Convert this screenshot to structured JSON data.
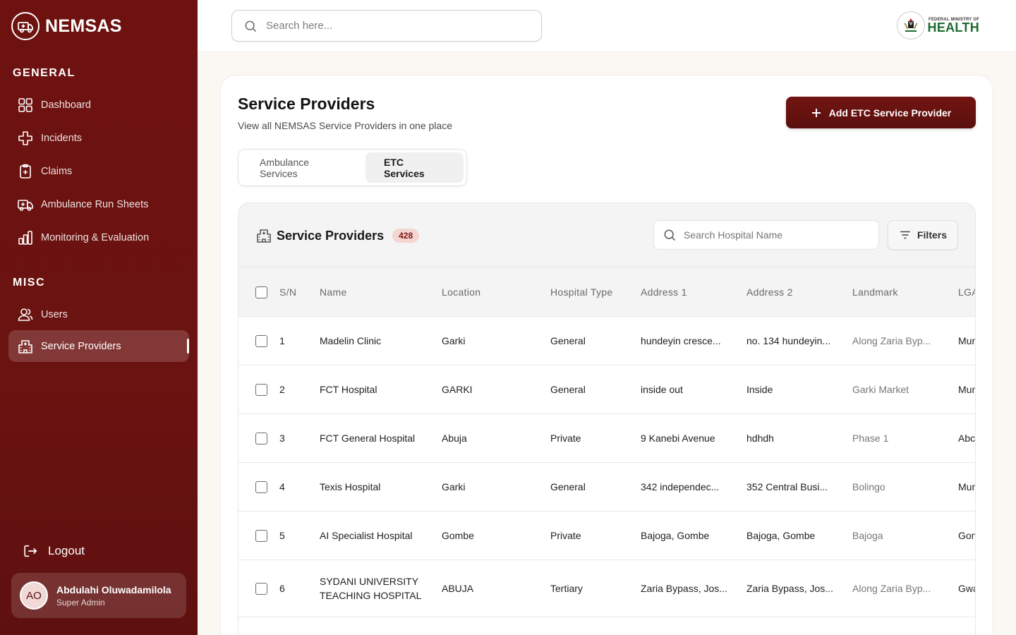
{
  "brand": {
    "name": "NEMSAS"
  },
  "sidebar": {
    "general_title": "GENERAL",
    "misc_title": "MISC",
    "items": [
      {
        "label": "Dashboard"
      },
      {
        "label": "Incidents"
      },
      {
        "label": "Claims"
      },
      {
        "label": "Ambulance Run Sheets"
      },
      {
        "label": "Monitoring & Evaluation"
      },
      {
        "label": "Users"
      },
      {
        "label": "Service Providers"
      }
    ],
    "logout_label": "Logout",
    "user": {
      "initials": "AO",
      "name": "Abdulahi Oluwadamilola",
      "role": "Super Admin"
    }
  },
  "header": {
    "search_placeholder": "Search here...",
    "ministry_small": "FEDERAL MINISTRY OF",
    "ministry_big": "HEALTH"
  },
  "page": {
    "title": "Service Providers",
    "subtitle": "View all NEMSAS Service Providers in one place",
    "add_button": "Add ETC Service Provider",
    "tabs": [
      {
        "label": "Ambulance Services",
        "active": false
      },
      {
        "label": "ETC Services",
        "active": true
      }
    ]
  },
  "panel": {
    "title": "Service Providers",
    "count": "428",
    "search_placeholder": "Search Hospital Name",
    "filters_label": "Filters"
  },
  "table": {
    "columns": [
      "S/N",
      "Name",
      "Location",
      "Hospital Type",
      "Address 1",
      "Address 2",
      "Landmark",
      "LGA"
    ],
    "rows": [
      {
        "sn": "1",
        "name": "Madelin Clinic",
        "location": "Garki",
        "type": "General",
        "address1": "hundeyin cresce...",
        "address2": "no. 134 hundeyin...",
        "landmark": "Along Zaria Byp...",
        "lga": "Mun"
      },
      {
        "sn": "2",
        "name": "FCT Hospital",
        "location": "GARKI",
        "type": "General",
        "address1": "inside out",
        "address2": "Inside",
        "landmark": "Garki Market",
        "lga": "Mun"
      },
      {
        "sn": "3",
        "name": "FCT General Hospital",
        "location": "Abuja",
        "type": "Private",
        "address1": "9 Kanebi Avenue",
        "address2": "hdhdh",
        "landmark": "Phase 1",
        "lga": "Abc"
      },
      {
        "sn": "4",
        "name": "Texis Hospital",
        "location": "Garki",
        "type": "General",
        "address1": "342 independec...",
        "address2": "352 Central Busi...",
        "landmark": "Bolingo",
        "lga": "Mun"
      },
      {
        "sn": "5",
        "name": "AI Specialist Hospital",
        "location": "Gombe",
        "type": "Private",
        "address1": "Bajoga, Gombe",
        "address2": "Bajoga, Gombe",
        "landmark": "Bajoga",
        "lga": "Gon"
      },
      {
        "sn": "6",
        "name": "SYDANI UNIVERSITY TEACHING HOSPITAL",
        "location": "ABUJA",
        "type": "Tertiary",
        "address1": "Zaria Bypass, Jos...",
        "address2": "Zaria Bypass, Jos...",
        "landmark": "Along Zaria Byp...",
        "lga": "Gwa"
      }
    ]
  },
  "colors": {
    "brand": "#6e1210",
    "badge_bg": "#f4d5d2",
    "health_green": "#1d6b2f"
  }
}
